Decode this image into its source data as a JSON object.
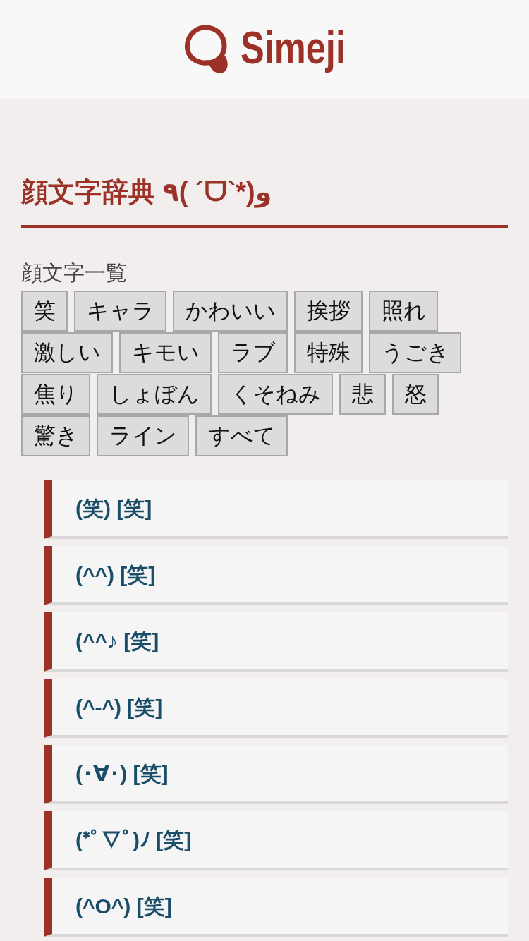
{
  "header": {
    "logo_text": "Simeji"
  },
  "page_title": "顔文字辞典 ٩( ´ᗜ`*)و",
  "category_heading": "顔文字一覧",
  "categories": [
    "笑",
    "キャラ",
    "かわいい",
    "挨拶",
    "照れ",
    "激しい",
    "キモい",
    "ラブ",
    "特殊",
    "うごき",
    "焦り",
    "しょぼん",
    "くそねみ",
    "悲",
    "怒",
    "驚き",
    "ライン",
    "すべて"
  ],
  "kaomoji_list": [
    "(笑) [笑]",
    "(^^) [笑]",
    "(^^♪ [笑]",
    "(^-^) [笑]",
    "(･∀･) [笑]",
    "(*ﾟ∇ﾟ)ﾉ [笑]",
    "(^O^) [笑]"
  ]
}
